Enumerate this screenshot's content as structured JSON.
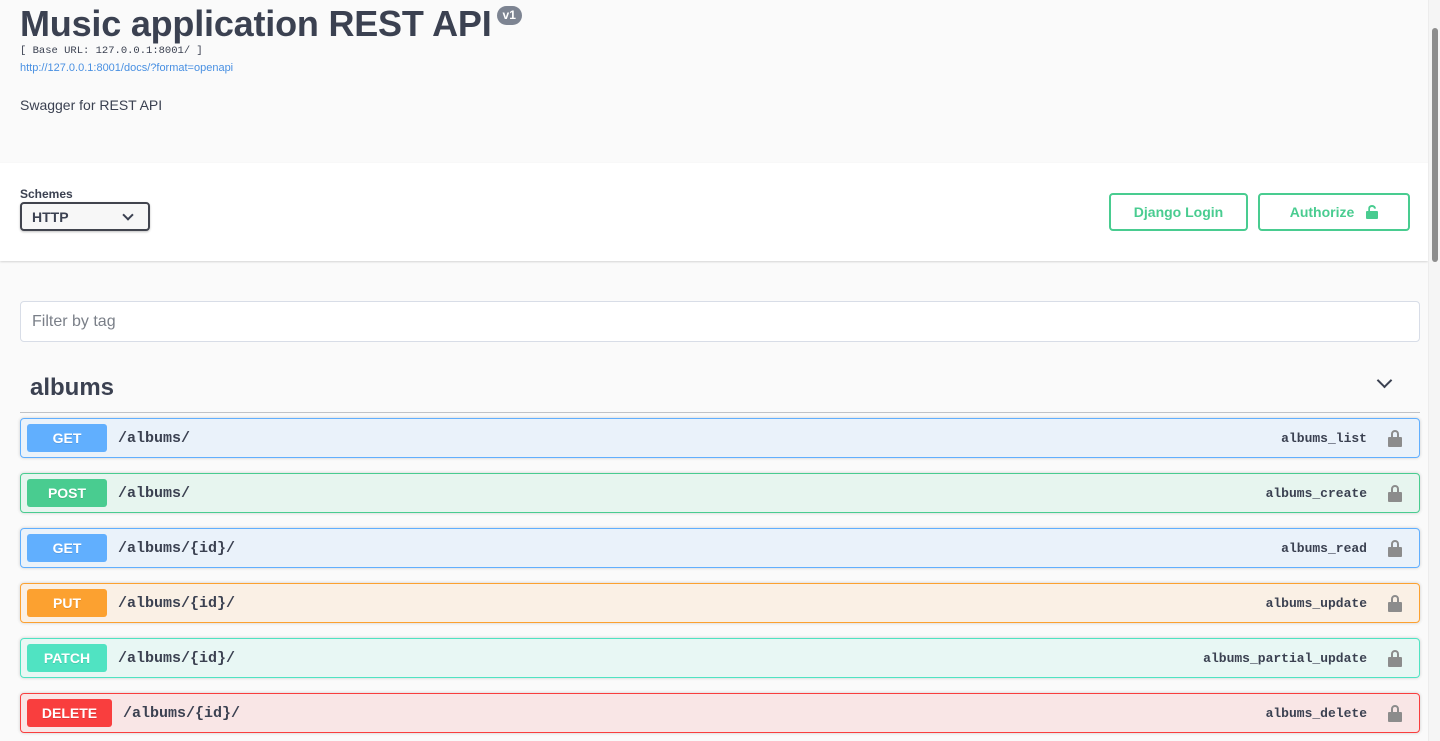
{
  "info": {
    "title": "Music application REST API",
    "version": "v1",
    "base_url": "[ Base URL: 127.0.0.1:8001/ ]",
    "spec_link": "http://127.0.0.1:8001/docs/?format=openapi",
    "description": "Swagger for REST API"
  },
  "schemes": {
    "label": "Schemes",
    "selected": "HTTP"
  },
  "buttons": {
    "django_login": "Django Login",
    "authorize": "Authorize"
  },
  "filter": {
    "placeholder": "Filter by tag"
  },
  "tag": {
    "name": "albums",
    "expanded": true
  },
  "operations": [
    {
      "method": "GET",
      "path": "/albums/",
      "operation_id": "albums_list"
    },
    {
      "method": "POST",
      "path": "/albums/",
      "operation_id": "albums_create"
    },
    {
      "method": "GET",
      "path": "/albums/{id}/",
      "operation_id": "albums_read"
    },
    {
      "method": "PUT",
      "path": "/albums/{id}/",
      "operation_id": "albums_update"
    },
    {
      "method": "PATCH",
      "path": "/albums/{id}/",
      "operation_id": "albums_partial_update"
    },
    {
      "method": "DELETE",
      "path": "/albums/{id}/",
      "operation_id": "albums_delete"
    }
  ],
  "colors": {
    "get": "#61affe",
    "post": "#49cc90",
    "put": "#fca130",
    "patch": "#50e3c2",
    "delete": "#f93e3e",
    "text": "#3b4151",
    "link": "#4990e2"
  },
  "icons": {
    "authorize": "lock-open-icon",
    "operation_lock": "lock-icon",
    "scheme_dropdown": "chevron-down-icon",
    "tag_toggle": "chevron-down-icon"
  }
}
